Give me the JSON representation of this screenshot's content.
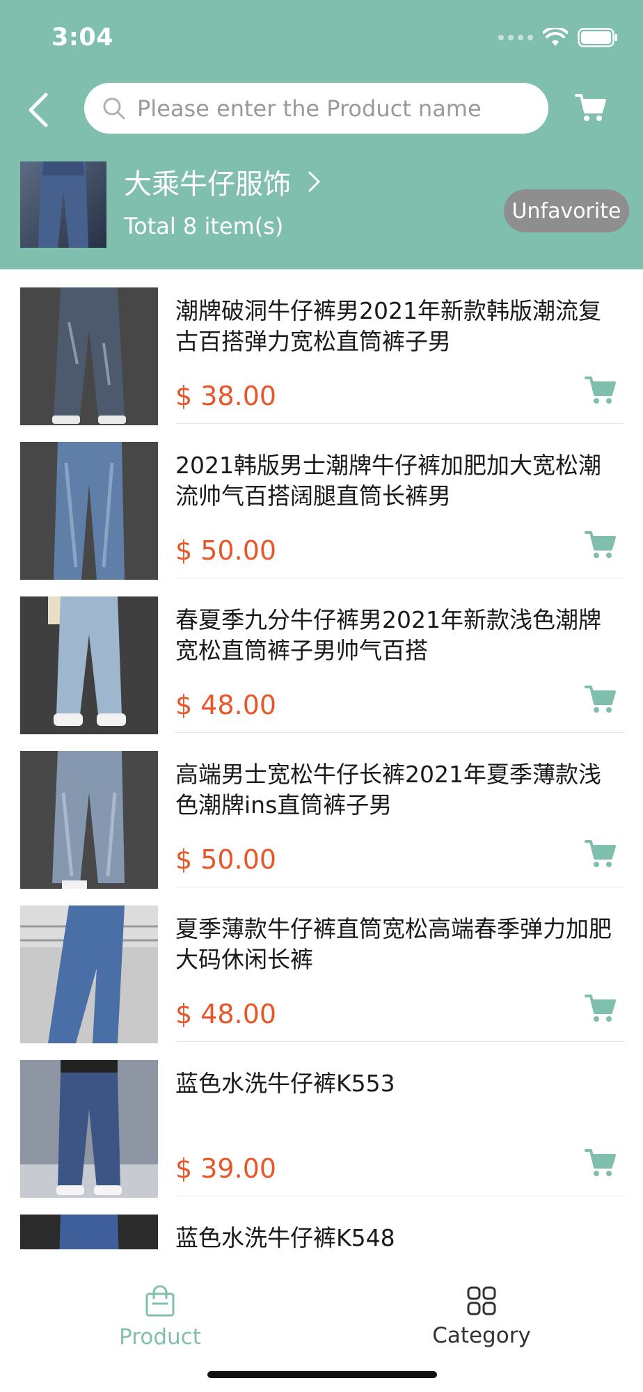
{
  "status_bar": {
    "time": "3:04"
  },
  "search": {
    "placeholder": "Please enter the Product name",
    "value": ""
  },
  "shop": {
    "name": "大乘牛仔服饰",
    "total": "Total 8 item(s)",
    "unfavorite_label": "Unfavorite"
  },
  "products": [
    {
      "title": "潮牌破洞牛仔裤男2021年新款韩版潮流复古百搭弹力宽松直筒裤子男",
      "price": "$ 38.00",
      "image": "dark-distressed-jeans"
    },
    {
      "title": "2021韩版男士潮牌牛仔裤加肥加大宽松潮流帅气百搭阔腿直筒长裤男",
      "price": "$ 50.00",
      "image": "blue-wide-leg-jeans"
    },
    {
      "title": "春夏季九分牛仔裤男2021年新款浅色潮牌宽松直筒裤子男帅气百搭",
      "price": "$ 48.00",
      "image": "light-cropped-jeans"
    },
    {
      "title": "高端男士宽松牛仔长裤2021年夏季薄款浅色潮牌ins直筒裤子男",
      "price": "$ 50.00",
      "image": "light-straight-jeans"
    },
    {
      "title": "夏季薄款牛仔裤直筒宽松高端春季弹力加肥大码休闲长裤",
      "price": "$ 48.00",
      "image": "blue-casual-jeans"
    },
    {
      "title": "蓝色水洗牛仔裤K553",
      "price": "$ 39.00",
      "image": "blue-washed-jeans"
    },
    {
      "title": "蓝色水洗牛仔裤K548",
      "price": "",
      "image": "blue-washed-jeans-2"
    }
  ],
  "tabs": [
    {
      "label": "Product",
      "icon": "shopping-bag-icon",
      "active": true
    },
    {
      "label": "Category",
      "icon": "grid-icon",
      "active": false
    }
  ],
  "colors": {
    "accent": "#80bfad",
    "price": "#e8572a",
    "unfavorite_bg": "#8e8e8e"
  }
}
